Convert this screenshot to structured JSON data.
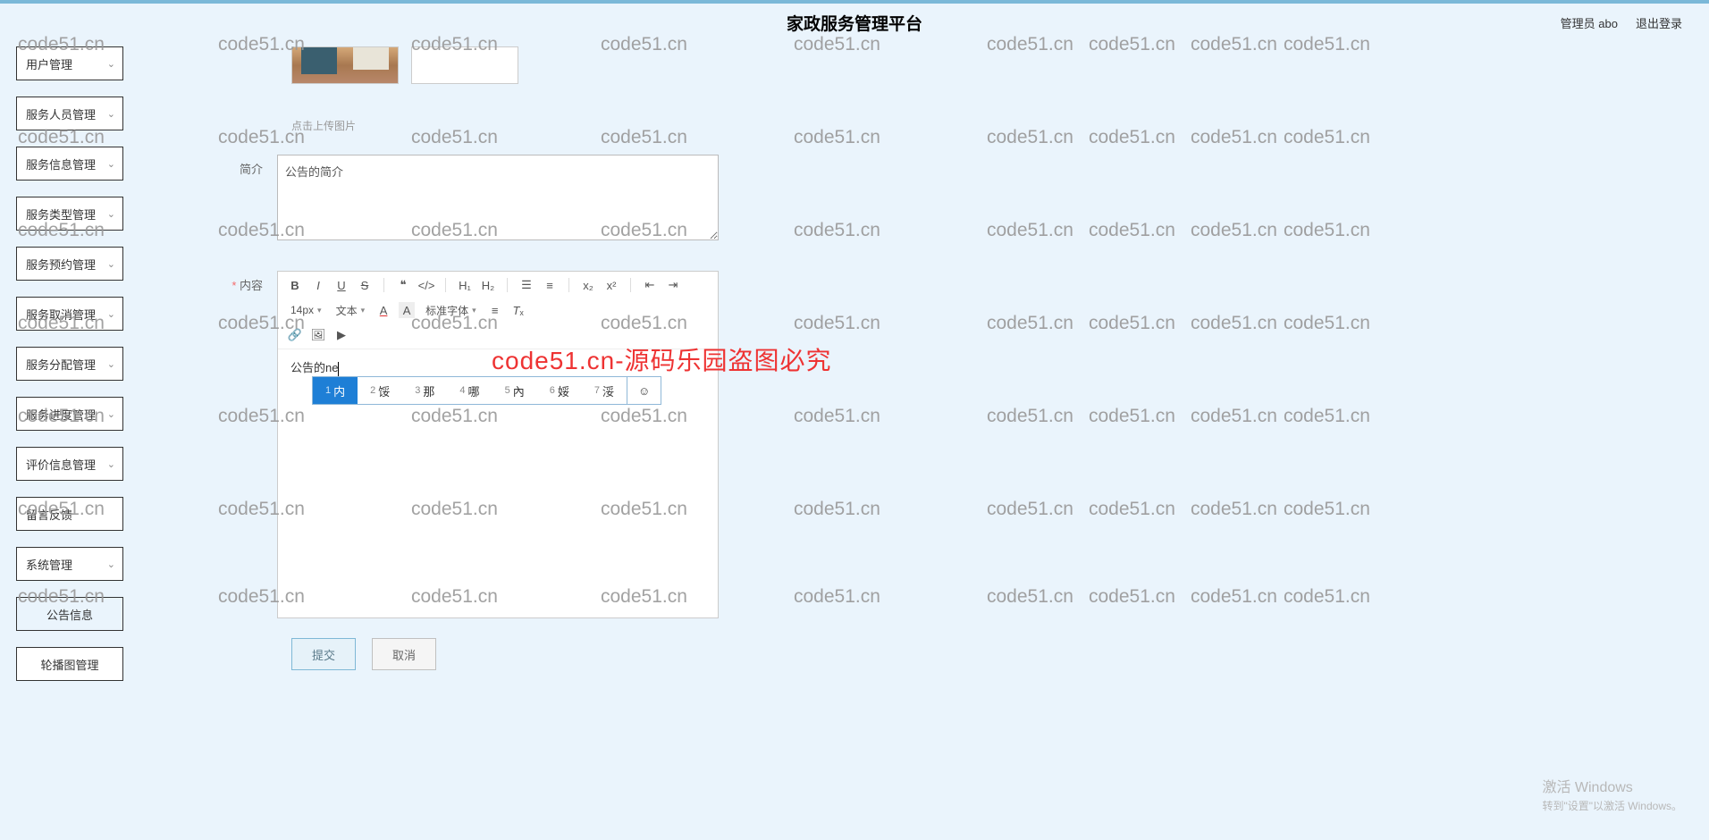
{
  "header": {
    "title": "家政服务管理平台",
    "admin_label": "管理员 abo",
    "logout_label": "退出登录"
  },
  "sidebar": {
    "items": [
      {
        "label": "用户管理",
        "expandable": true
      },
      {
        "label": "服务人员管理",
        "expandable": true
      },
      {
        "label": "服务信息管理",
        "expandable": true
      },
      {
        "label": "服务类型管理",
        "expandable": true
      },
      {
        "label": "服务预约管理",
        "expandable": true
      },
      {
        "label": "服务取消管理",
        "expandable": true
      },
      {
        "label": "服务分配管理",
        "expandable": true
      },
      {
        "label": "服务进度管理",
        "expandable": true
      },
      {
        "label": "评价信息管理",
        "expandable": true
      },
      {
        "label": "留言反馈",
        "expandable": false
      },
      {
        "label": "系统管理",
        "expandable": true
      },
      {
        "label": "公告信息",
        "expandable": false,
        "sub": true,
        "active": true
      },
      {
        "label": "轮播图管理",
        "expandable": false,
        "sub": true
      }
    ]
  },
  "form": {
    "upload_hint": "点击上传图片",
    "intro_label": "简介",
    "intro_value": "公告的简介",
    "content_label": "内容",
    "editor_text": "公告的ne",
    "submit_label": "提交",
    "cancel_label": "取消"
  },
  "editor_toolbar": {
    "font_size": "14px",
    "font_style": "文本",
    "font_family": "标准字体"
  },
  "ime": {
    "candidates": [
      {
        "num": "1",
        "text": "内"
      },
      {
        "num": "2",
        "text": "馁"
      },
      {
        "num": "3",
        "text": "那"
      },
      {
        "num": "4",
        "text": "哪"
      },
      {
        "num": "5",
        "text": "內"
      },
      {
        "num": "6",
        "text": "娞"
      },
      {
        "num": "7",
        "text": "浽"
      }
    ]
  },
  "watermark_text": "code51.cn",
  "watermark_red": "code51.cn-源码乐园盗图必究",
  "windows": {
    "line1": "激活 Windows",
    "line2": "转到\"设置\"以激活 Windows。"
  }
}
